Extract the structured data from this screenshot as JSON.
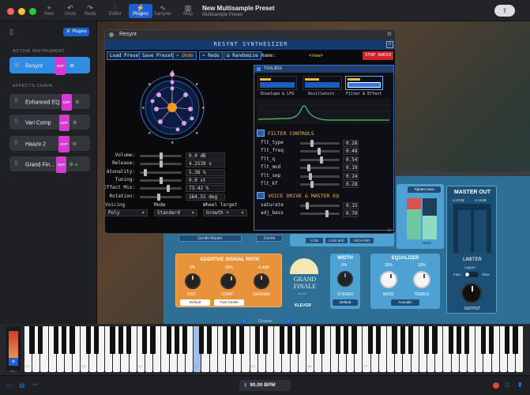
{
  "titlebar": {
    "buttons": [
      {
        "label": "New",
        "icon": "plus"
      },
      {
        "label": "Undo",
        "icon": "undo"
      },
      {
        "label": "Redo",
        "icon": "redo"
      },
      {
        "label": "Editor",
        "icon": "sliders"
      },
      {
        "label": "Plugins",
        "icon": "plug"
      },
      {
        "label": "Sampler",
        "icon": "wave"
      },
      {
        "label": "Map",
        "icon": "keyboard"
      }
    ],
    "title": "New Multisample Preset",
    "subtitle": "Multisample Preset"
  },
  "sidebar": {
    "plugins_btn": "Plugins",
    "active_header": "ACTIVE INSTRUMENT",
    "active": {
      "name": "Resynt",
      "badge": "DDP"
    },
    "effects_header": "EFFECTS CHAIN",
    "effects": [
      {
        "name": "Enhanced EQ",
        "badge": "DDP"
      },
      {
        "name": "Vari Comp",
        "badge": "DDP"
      },
      {
        "name": "Haaze 2",
        "badge": "DDP"
      },
      {
        "name": "Grand Fin...",
        "badge": "DDP"
      }
    ]
  },
  "resynt": {
    "window_title": "Resynt",
    "title": "RESYNT SYNTHESIZER",
    "load": "Load Preset",
    "save": "Save Preset",
    "undo": "Undo",
    "redo": "Redo",
    "randomize": "Randomize",
    "name_label": "Name:",
    "name_value": "<new>",
    "stop": "STOP AUDIO",
    "params": [
      {
        "label": "Volume:",
        "value": "0.0 dB",
        "pos": 0.5
      },
      {
        "label": "Release:",
        "value": "4.2539 s",
        "pos": 0.5
      },
      {
        "label": "Atonality:",
        "value": "5.36 %",
        "pos": 0.1
      },
      {
        "label": "Tuning:",
        "value": "0.0 st",
        "pos": 0.5
      },
      {
        "label": "Effect Mix:",
        "value": "73.42 %",
        "pos": 0.7
      },
      {
        "label": "Rotation:",
        "value": "164.51 deg",
        "pos": 0.45
      }
    ],
    "voicing_label": "Voicing",
    "voicing": "Poly",
    "mode_label": "Mode",
    "mode": "Standard",
    "wheel_label": "Wheel Target",
    "wheel": "Growth +",
    "toolbox": "TOOLBOX",
    "tools": [
      "Envelope & LFO",
      "Oscillators",
      "Filter & Effect"
    ],
    "filter_header": "FILTER CONTROLS",
    "filter": [
      {
        "label": "flt_type",
        "value": "0.28"
      },
      {
        "label": "flt_freq",
        "value": "0.48"
      },
      {
        "label": "flt_q",
        "value": "0.54"
      },
      {
        "label": "flt_mod",
        "value": "0.19"
      },
      {
        "label": "flt_sep",
        "value": "0.24"
      },
      {
        "label": "flt_kf",
        "value": "0.28"
      }
    ],
    "drive_header": "VOICE DRIVE & MASTER EQ",
    "drive": [
      {
        "label": "saturate",
        "value": "0.15"
      },
      {
        "label": "adj_bass",
        "value": "0.70"
      }
    ]
  },
  "grand": {
    "gentle_master": "Gentle Master",
    "gentle": "Gentle",
    "low": "LOW",
    "low_mid": "LOW MID",
    "high_mid": "HIGH MID",
    "high": "HIGH",
    "tighten": "Tighten bass",
    "master_out": "MASTER OUT",
    "lvl_l": "-4.87dB",
    "lvl_r": "-0.10dB",
    "cap": "CLIP",
    "limiter": "LIMITER",
    "lgpm": "Lagom",
    "fast": "Fast",
    "slow": "Slow",
    "output": "OUTPUT",
    "additive": "ADDITIVE SIGNAL PATH",
    "dist_val": "0%",
    "comp_val": "65%",
    "gain_val": "-6.4dB",
    "dist": "DIST",
    "comp": "COMP",
    "gain": "GAIN/MIX",
    "default": "Default",
    "fast_gentle": "Fast Gentle",
    "logo1": "GRAND",
    "logo2": "FINALE",
    "ver": "v2.0.2",
    "klevgr": "KLEVGR",
    "width": "WIDTH",
    "width_val": "0%",
    "stereo": "STEREO",
    "width_default": "Default",
    "equalizer": "EQUALIZER",
    "bass_val": "30%",
    "treble_val": "30%",
    "bass": "BASS",
    "treble": "TREBLE",
    "acoustic": "Acoustic"
  },
  "keyboard": {
    "octave": "Octave",
    "notes": [
      "C1",
      "C2",
      "C3",
      "C4",
      "C5",
      "C6",
      "C7"
    ],
    "vel": "VEL"
  },
  "footer": {
    "bpm": "90.00 BPM"
  }
}
